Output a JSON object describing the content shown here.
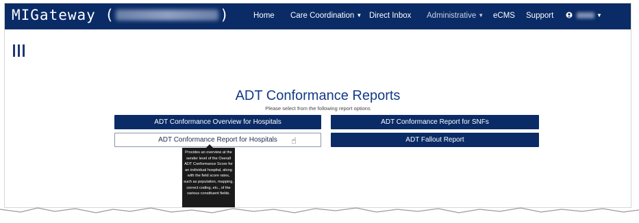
{
  "app": {
    "brand_prefix": "MIGateway (",
    "brand_suffix": ")"
  },
  "nav": {
    "items": [
      {
        "label": "Home"
      },
      {
        "label": "Care Coordination"
      },
      {
        "label": "Direct Inbox"
      },
      {
        "label": "Administrative"
      },
      {
        "label": "eCMS"
      },
      {
        "label": "Support"
      }
    ]
  },
  "main": {
    "title": "ADT Conformance Reports",
    "subtitle": "Please select from the following report options",
    "buttons": [
      {
        "label": "ADT Conformance Overview for Hospitals"
      },
      {
        "label": "ADT Conformance Report for SNFs"
      },
      {
        "label": "ADT Conformance Report for Hospitals"
      },
      {
        "label": "ADT Fallout Report"
      }
    ]
  },
  "tooltip": {
    "lines": [
      "Provides an overview at the",
      "sender level of the Overall",
      "ADT Conformance Score for",
      "an individual hospital, along",
      "with the field score rates,",
      "such as population, mapping,",
      "correct coding, etc., of the",
      "various constituent fields."
    ]
  },
  "colors": {
    "navbar": "#0a2b66",
    "primary_button": "#0a2b66",
    "title": "#123a86"
  },
  "icons": {
    "menu": "menu-bars-icon",
    "user": "user-circle-icon",
    "cursor": "hand-pointer-icon"
  }
}
